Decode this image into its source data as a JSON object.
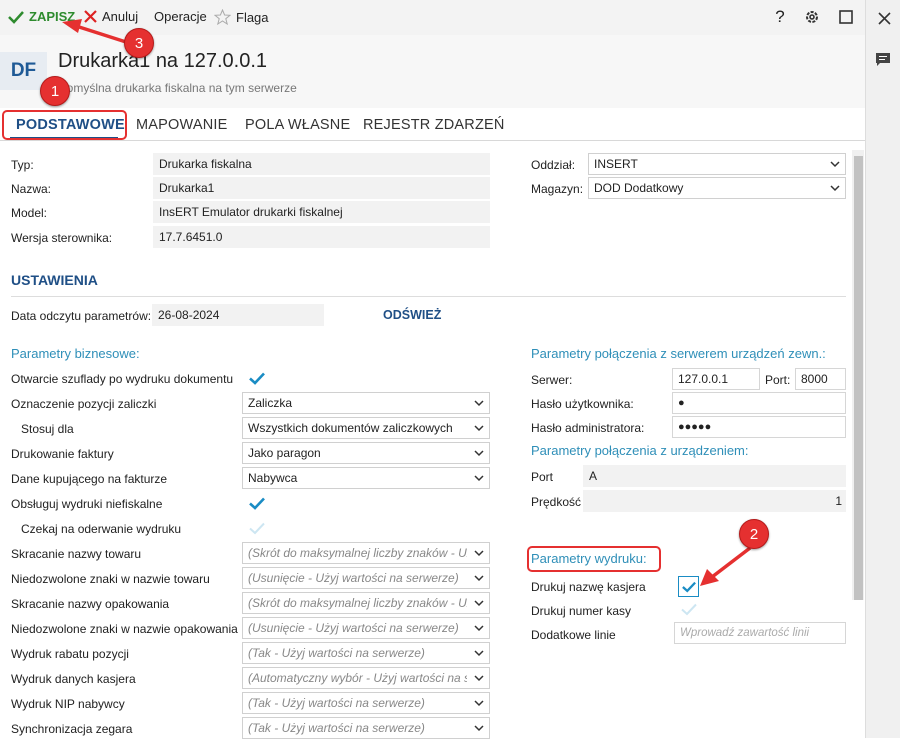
{
  "toolbar": {
    "save_label": "ZAPISZ",
    "cancel_label": "Anuluj",
    "operations_label": "Operacje",
    "flag_label": "Flaga",
    "help_label": "?"
  },
  "header": {
    "avatar": "DF",
    "title": "Drukarka1 na 127.0.0.1",
    "subtitle": "Domyślna drukarka fiskalna na tym serwerze"
  },
  "tabs": [
    "PODSTAWOWE",
    "MAPOWANIE",
    "POLA WŁASNE",
    "REJESTR ZDARZEŃ"
  ],
  "basic": {
    "type_label": "Typ:",
    "type_value": "Drukarka fiskalna",
    "name_label": "Nazwa:",
    "name_value": "Drukarka1",
    "model_label": "Model:",
    "model_value": "InsERT Emulator drukarki fiskalnej",
    "driver_label": "Wersja sterownika:",
    "driver_value": "17.7.6451.0",
    "branch_label": "Oddział:",
    "branch_value": "INSERT",
    "warehouse_label": "Magazyn:",
    "warehouse_value": "DOD Dodatkowy"
  },
  "settings": {
    "heading": "USTAWIENIA",
    "read_date_label": "Data odczytu parametrów:",
    "read_date_value": "26-08-2024",
    "refresh_label": "ODŚWIEŻ"
  },
  "business": {
    "title": "Parametry biznesowe:",
    "rows": [
      {
        "label": "Otwarcie szuflady po wydruku dokumentu",
        "value": ""
      },
      {
        "label": "Oznaczenie pozycji zaliczki",
        "value": "Zaliczka"
      },
      {
        "label": "Stosuj dla",
        "value": "Wszystkich dokumentów zaliczkowych"
      },
      {
        "label": "Drukowanie faktury",
        "value": "Jako paragon"
      },
      {
        "label": "Dane kupującego na fakturze",
        "value": "Nabywca"
      },
      {
        "label": "Obsługuj wydruki niefiskalne",
        "value": ""
      },
      {
        "label": "Czekaj na oderwanie wydruku",
        "value": ""
      },
      {
        "label": "Skracanie nazwy towaru",
        "value": "(Skrót do maksymalnej liczby znaków - Użyj wartości na serwerze)"
      },
      {
        "label": "Niedozwolone znaki w nazwie towaru",
        "value": "(Usunięcie - Użyj wartości na serwerze)"
      },
      {
        "label": "Skracanie nazwy opakowania",
        "value": "(Skrót do maksymalnej liczby znaków - Użyj wartości na serwerze)"
      },
      {
        "label": "Niedozwolone znaki w nazwie opakowania",
        "value": "(Usunięcie - Użyj wartości na serwerze)"
      },
      {
        "label": "Wydruk rabatu pozycji",
        "value": "(Tak - Użyj wartości na serwerze)"
      },
      {
        "label": "Wydruk danych kasjera",
        "value": "(Automatyczny wybór - Użyj wartości na serwerze)"
      },
      {
        "label": "Wydruk NIP nabywcy",
        "value": "(Tak - Użyj wartości na serwerze)"
      },
      {
        "label": "Synchronizacja zegara",
        "value": "(Tak - Użyj wartości na serwerze)"
      }
    ]
  },
  "server_conn": {
    "title": "Parametry połączenia z serwerem urządzeń zewn.:",
    "server_label": "Serwer:",
    "server_value": "127.0.0.1",
    "port_label": "Port:",
    "port_value": "8000",
    "user_pw_label": "Hasło użytkownika:",
    "user_pw_value": "●",
    "admin_pw_label": "Hasło administratora:",
    "admin_pw_value": "●●●●●"
  },
  "device_conn": {
    "title": "Parametry połączenia z urządzeniem:",
    "port_label": "Port",
    "port_value": "A",
    "speed_label": "Prędkość",
    "speed_value": "1"
  },
  "print_params": {
    "title": "Parametry wydruku:",
    "cashier_label": "Drukuj nazwę kasjera",
    "register_label": "Drukuj numer kasy",
    "extra_lines_label": "Dodatkowe linie",
    "extra_lines_placeholder": "Wprowadź zawartość linii"
  },
  "annotations": [
    "1",
    "2",
    "3"
  ],
  "colors": {
    "accent": "#1f4f86",
    "section": "#2f8fb8",
    "check": "#1a8cc4",
    "annotation": "#e53030",
    "save": "#2e8b2e"
  }
}
